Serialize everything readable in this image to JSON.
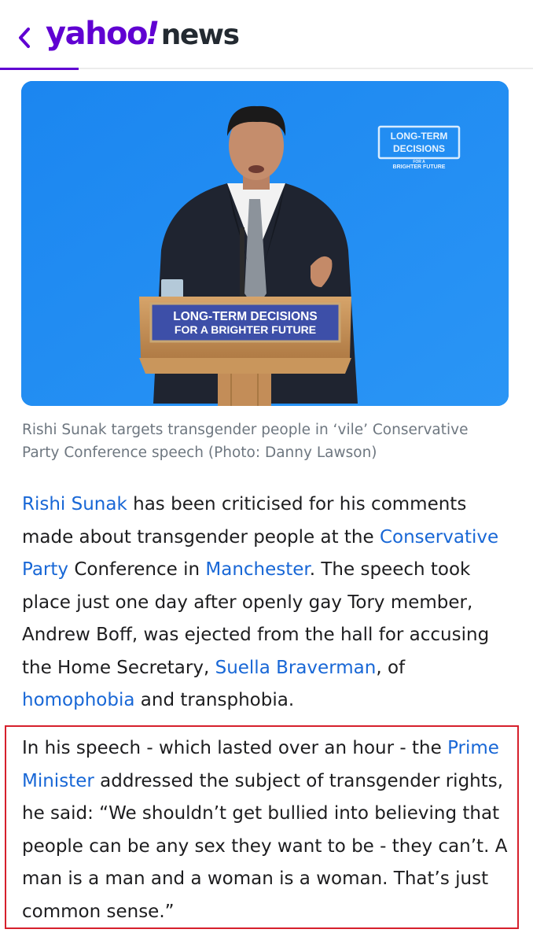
{
  "header": {
    "back_label": "‹",
    "logo_yahoo": "yahoo",
    "logo_bang": "!",
    "logo_news": "news"
  },
  "hero": {
    "backdrop_logo_lines": [
      "LONG-TERM",
      "DECISIONS",
      "FOR A",
      "BRIGHTER FUTURE"
    ],
    "podium_line1": "LONG-TERM DECISIONS",
    "podium_line2": "FOR A BRIGHTER FUTURE",
    "background_color": "#1f8cf3"
  },
  "caption": "Rishi Sunak targets transgender people in ‘vile’ Conservative Party Conference speech (Photo: Danny Lawson)",
  "paragraph1": {
    "link_rishi": "Rishi Sunak",
    "t1": " has been criticised for his comments made about transgender people at the ",
    "link_conservative": "Conservative Party",
    "t2": " Conference in ",
    "link_manchester": "Manchester",
    "t3": ". The speech took place just one day after openly gay Tory member, Andrew Boff, was ejected from the hall for accusing the Home Secretary, ",
    "link_suella": "Suella Braverman",
    "t4": ", of ",
    "link_homophobia": "homophobia",
    "t5": " and transphobia."
  },
  "paragraph2": {
    "t1": "In his speech - which lasted over an hour - the ",
    "link_pm": "Prime Minister",
    "t2": " addressed the subject of transgender rights, he said: “We shouldn’t get bullied into believing that people can be any sex they want to be - they can’t. A man is a man and a woman is a woman. That’s just common sense.”"
  },
  "colors": {
    "brand_purple": "#6001d2",
    "link_blue": "#1867d6",
    "highlight_red": "#d6202c"
  }
}
